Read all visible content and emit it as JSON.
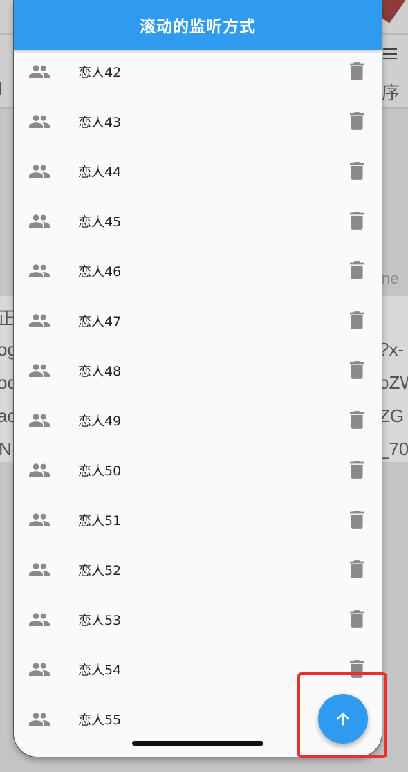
{
  "app_bar": {
    "title": "滚动的监听方式"
  },
  "list_items": [
    {
      "label": "恋人42"
    },
    {
      "label": "恋人43"
    },
    {
      "label": "恋人44"
    },
    {
      "label": "恋人45"
    },
    {
      "label": "恋人46"
    },
    {
      "label": "恋人47"
    },
    {
      "label": "恋人48"
    },
    {
      "label": "恋人49"
    },
    {
      "label": "恋人50"
    },
    {
      "label": "恋人51"
    },
    {
      "label": "恋人52"
    },
    {
      "label": "恋人53"
    },
    {
      "label": "恋人54"
    },
    {
      "label": "恋人55"
    }
  ],
  "icons": {
    "leading": "people-icon",
    "trailing": "trash-icon",
    "fab": "arrow-up-icon"
  },
  "fab": {
    "action": "scroll-to-top"
  },
  "background_fragments": {
    "f1": "l",
    "f2": "序",
    "f3": "ne",
    "f4": "正",
    "f5": "og",
    "f6": "?x-",
    "f7": "oo",
    "f8": "oZW",
    "f9": "ac",
    "f10": "ZG",
    "f11": "N",
    "f12": "_70"
  },
  "colors": {
    "primary": "#2f9bf0",
    "highlight": "#e5322d",
    "icon": "#8a8a8a"
  }
}
